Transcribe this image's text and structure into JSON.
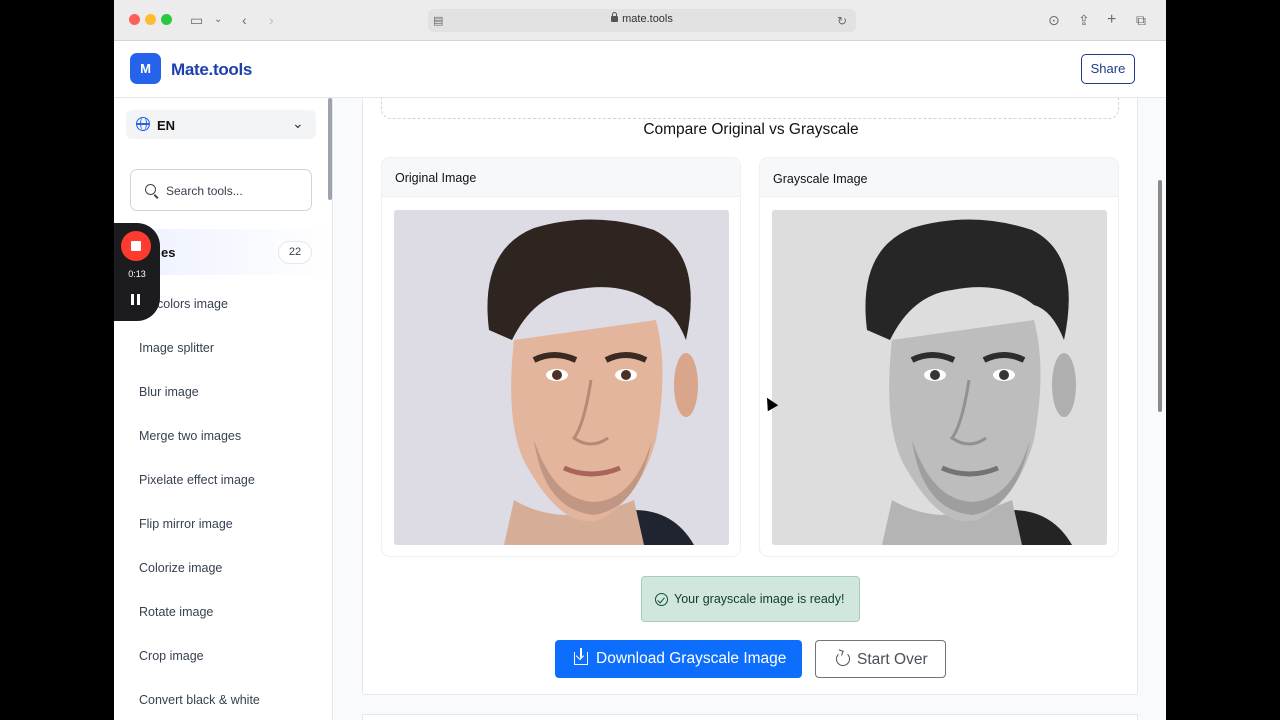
{
  "browser": {
    "url": "mate.tools"
  },
  "header": {
    "logo_letter": "M",
    "logo_text": "Mate.tools",
    "share_label": "Share"
  },
  "sidebar": {
    "language": "EN",
    "search_placeholder": "Search tools...",
    "category": {
      "label": "es",
      "count": "22"
    },
    "items": [
      "ert colors image",
      "Image splitter",
      "Blur image",
      "Merge two images",
      "Pixelate effect image",
      "Flip mirror image",
      "Colorize image",
      "Rotate image",
      "Crop image",
      "Convert black & white"
    ]
  },
  "recorder": {
    "time": "0:13"
  },
  "main": {
    "compare_title": "Compare Original vs Grayscale",
    "original_title": "Original Image",
    "grayscale_title": "Grayscale Image",
    "success_message": "Your grayscale image is ready!",
    "download_label": "Download Grayscale Image",
    "start_over_label": "Start Over"
  },
  "colors": {
    "brand": "#2563eb",
    "primary_button": "#0d6efd",
    "success_bg": "#d1e7dd",
    "recorder_red": "#ff3b30"
  }
}
